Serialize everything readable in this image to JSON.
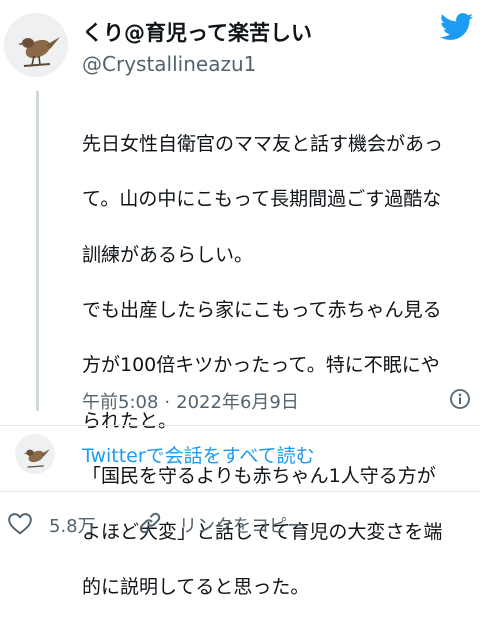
{
  "author": {
    "display_name": "くり@育児って楽苦しい",
    "handle": "@Crystallineazu1"
  },
  "tweet": {
    "lines": [
      "先日女性自衛官のママ友と話す機会があっ",
      "て。山の中にこもって長期間過ごす過酷な",
      "訓練があるらしい。",
      "でも出産したら家にこもって赤ちゃん見る",
      "方が100倍キツかったって。特に不眠にや",
      "られたと。",
      "「国民を守るよりも赤ちゃん1人守る方が",
      "よほど大変」と話してて育児の大変さを端",
      "的に説明してると思った。"
    ],
    "time": "午前5:08",
    "separator": "·",
    "date": "2022年6月9日"
  },
  "conversation": {
    "link_label": "Twitterで会話をすべて読む"
  },
  "actions": {
    "likes_count": "5.8万",
    "copy_link_label": "リンクをコピー"
  },
  "icons": {
    "brand": "twitter-bird-icon",
    "info": "info-icon",
    "like": "heart-icon",
    "copy": "link-icon"
  },
  "colors": {
    "brand": "#1d9bf0",
    "text": "#0f1419",
    "secondary": "#536471"
  }
}
